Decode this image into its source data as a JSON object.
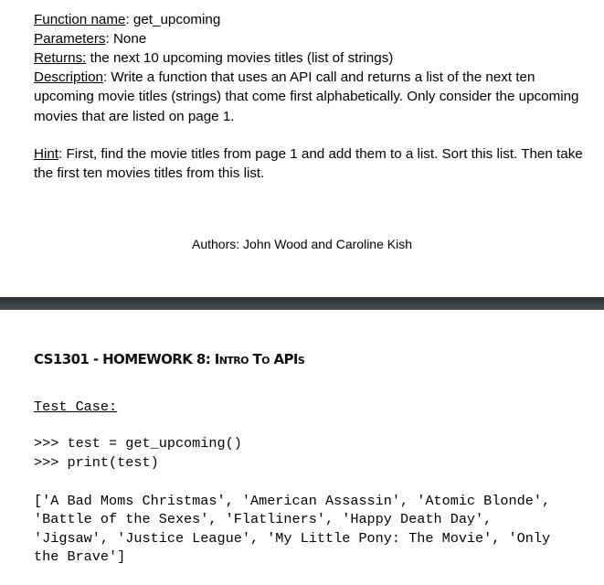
{
  "spec": {
    "function_name": {
      "label": "Function name",
      "value": ": get_upcoming"
    },
    "parameters": {
      "label": "Parameters",
      "value": ": None"
    },
    "returns": {
      "label": "Returns:",
      "value": " the next 10 upcoming movies titles (list of strings)"
    },
    "description": {
      "label": "Description",
      "value": ": Write a function that uses an API call and returns a list of the next ten upcoming movie titles (strings) that come first alphabetically. Only consider the upcoming movies that are listed on page 1."
    },
    "hint": {
      "label": "Hint",
      "value": ": First, find the movie titles from page 1 and add them to a list. Sort this list. Then take the first ten movies titles from this list."
    },
    "authors": "Authors: John Wood and Caroline Kish"
  },
  "next_page": {
    "header": "CS1301 - HOMEWORK 8: Intro To APIs",
    "test_case_title": "Test Case:",
    "code_lines": [
      ">>> test = get_upcoming()",
      ">>> print(test)"
    ],
    "output_lines": [
      "['A Bad Moms Christmas', 'American Assassin', 'Atomic Blonde',",
      "'Battle of the Sexes', 'Flatliners', 'Happy Death Day',",
      "'Jigsaw', 'Justice League', 'My Little Pony: The Movie', 'Only",
      "the Brave']"
    ]
  }
}
